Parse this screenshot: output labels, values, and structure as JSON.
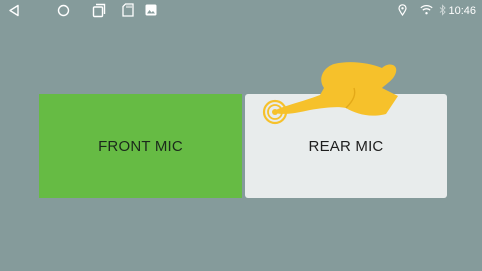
{
  "status_bar": {
    "time": "10:46",
    "icons": [
      "back-icon",
      "home-icon",
      "recents-icon",
      "sd-card-icon",
      "image-icon",
      "location-icon",
      "wifi-icon",
      "bluetooth-icon"
    ]
  },
  "buttons": {
    "front_label": "FRONT MIC",
    "rear_label": "REAR MIC"
  },
  "colors": {
    "background": "#859b9b",
    "front_button": "#66bb44",
    "rear_button": "#e8ecec",
    "hand": "#f6c12b"
  }
}
